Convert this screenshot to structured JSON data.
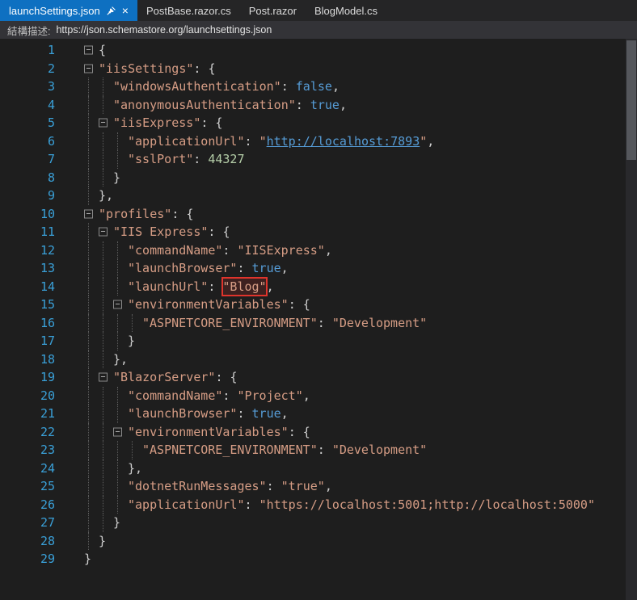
{
  "tabs": [
    {
      "label": "launchSettings.json",
      "active": true
    },
    {
      "label": "PostBase.razor.cs",
      "active": false
    },
    {
      "label": "Post.razor",
      "active": false
    },
    {
      "label": "BlogModel.cs",
      "active": false
    }
  ],
  "icons": {
    "close": "×",
    "fold_collapse": "−"
  },
  "schema_bar": {
    "label": "結構描述:",
    "url": "https://json.schemastore.org/launchsettings.json"
  },
  "colors": {
    "accent": "#0e70c1",
    "editor_bg": "#1e1e1e",
    "tabbar_bg": "#252526",
    "schemabar_bg": "#333337",
    "line_number": "#3aa0d8",
    "string": "#d69d85",
    "keyword": "#569cd6",
    "number": "#b5cea8",
    "punctuation": "#d0d0d0",
    "link": "#569cd6",
    "highlight_red": "#e0342c"
  },
  "editor": {
    "lines": [
      {
        "n": 1,
        "pre": [
          "box"
        ],
        "tokens": [
          [
            "punc",
            "{"
          ]
        ]
      },
      {
        "n": 2,
        "pre": [
          "box"
        ],
        "tokens": [
          [
            "str",
            "\"iisSettings\""
          ],
          [
            "punc",
            ": {"
          ]
        ]
      },
      {
        "n": 3,
        "pre": [
          "g",
          "g"
        ],
        "tokens": [
          [
            "str",
            "\"windowsAuthentication\""
          ],
          [
            "punc",
            ": "
          ],
          [
            "kw",
            "false"
          ],
          [
            "punc",
            ","
          ]
        ]
      },
      {
        "n": 4,
        "pre": [
          "g",
          "g"
        ],
        "tokens": [
          [
            "str",
            "\"anonymousAuthentication\""
          ],
          [
            "punc",
            ": "
          ],
          [
            "kw",
            "true"
          ],
          [
            "punc",
            ","
          ]
        ]
      },
      {
        "n": 5,
        "pre": [
          "g",
          "box"
        ],
        "tokens": [
          [
            "str",
            "\"iisExpress\""
          ],
          [
            "punc",
            ": {"
          ]
        ]
      },
      {
        "n": 6,
        "pre": [
          "g",
          "g",
          "g"
        ],
        "tokens": [
          [
            "str",
            "\"applicationUrl\""
          ],
          [
            "punc",
            ": "
          ],
          [
            "str",
            "\""
          ],
          [
            "link",
            "http://localhost:7893"
          ],
          [
            "str",
            "\""
          ],
          [
            "punc",
            ","
          ]
        ]
      },
      {
        "n": 7,
        "pre": [
          "g",
          "g",
          "g"
        ],
        "tokens": [
          [
            "str",
            "\"sslPort\""
          ],
          [
            "punc",
            ": "
          ],
          [
            "num",
            "44327"
          ]
        ]
      },
      {
        "n": 8,
        "pre": [
          "g",
          "g"
        ],
        "tokens": [
          [
            "punc",
            "}"
          ]
        ]
      },
      {
        "n": 9,
        "pre": [
          "g"
        ],
        "tokens": [
          [
            "punc",
            "},"
          ]
        ]
      },
      {
        "n": 10,
        "pre": [
          "box"
        ],
        "tokens": [
          [
            "str",
            "\"profiles\""
          ],
          [
            "punc",
            ": {"
          ]
        ]
      },
      {
        "n": 11,
        "pre": [
          "g",
          "box"
        ],
        "tokens": [
          [
            "str",
            "\"IIS Express\""
          ],
          [
            "punc",
            ": {"
          ]
        ]
      },
      {
        "n": 12,
        "pre": [
          "g",
          "g",
          "g"
        ],
        "tokens": [
          [
            "str",
            "\"commandName\""
          ],
          [
            "punc",
            ": "
          ],
          [
            "str",
            "\"IISExpress\""
          ],
          [
            "punc",
            ","
          ]
        ]
      },
      {
        "n": 13,
        "pre": [
          "g",
          "g",
          "g"
        ],
        "tokens": [
          [
            "str",
            "\"launchBrowser\""
          ],
          [
            "punc",
            ": "
          ],
          [
            "kw",
            "true"
          ],
          [
            "punc",
            ","
          ]
        ]
      },
      {
        "n": 14,
        "pre": [
          "g",
          "g",
          "g"
        ],
        "tokens": [
          [
            "str",
            "\"launchUrl\""
          ],
          [
            "punc",
            ": "
          ],
          [
            "hl",
            "\"Blog\""
          ],
          [
            "punc",
            ","
          ]
        ]
      },
      {
        "n": 15,
        "pre": [
          "g",
          "g",
          "box"
        ],
        "tokens": [
          [
            "str",
            "\"environmentVariables\""
          ],
          [
            "punc",
            ": {"
          ]
        ]
      },
      {
        "n": 16,
        "pre": [
          "g",
          "g",
          "g",
          "g"
        ],
        "tokens": [
          [
            "str",
            "\"ASPNETCORE_ENVIRONMENT\""
          ],
          [
            "punc",
            ": "
          ],
          [
            "str",
            "\"Development\""
          ]
        ]
      },
      {
        "n": 17,
        "pre": [
          "g",
          "g",
          "g"
        ],
        "tokens": [
          [
            "punc",
            "}"
          ]
        ]
      },
      {
        "n": 18,
        "pre": [
          "g",
          "g"
        ],
        "tokens": [
          [
            "punc",
            "},"
          ]
        ]
      },
      {
        "n": 19,
        "pre": [
          "g",
          "box"
        ],
        "tokens": [
          [
            "str",
            "\"BlazorServer\""
          ],
          [
            "punc",
            ": {"
          ]
        ]
      },
      {
        "n": 20,
        "pre": [
          "g",
          "g",
          "g"
        ],
        "tokens": [
          [
            "str",
            "\"commandName\""
          ],
          [
            "punc",
            ": "
          ],
          [
            "str",
            "\"Project\""
          ],
          [
            "punc",
            ","
          ]
        ]
      },
      {
        "n": 21,
        "pre": [
          "g",
          "g",
          "g"
        ],
        "tokens": [
          [
            "str",
            "\"launchBrowser\""
          ],
          [
            "punc",
            ": "
          ],
          [
            "kw",
            "true"
          ],
          [
            "punc",
            ","
          ]
        ]
      },
      {
        "n": 22,
        "pre": [
          "g",
          "g",
          "box"
        ],
        "tokens": [
          [
            "str",
            "\"environmentVariables\""
          ],
          [
            "punc",
            ": {"
          ]
        ]
      },
      {
        "n": 23,
        "pre": [
          "g",
          "g",
          "g",
          "g"
        ],
        "tokens": [
          [
            "str",
            "\"ASPNETCORE_ENVIRONMENT\""
          ],
          [
            "punc",
            ": "
          ],
          [
            "str",
            "\"Development\""
          ]
        ]
      },
      {
        "n": 24,
        "pre": [
          "g",
          "g",
          "g"
        ],
        "tokens": [
          [
            "punc",
            "},"
          ]
        ]
      },
      {
        "n": 25,
        "pre": [
          "g",
          "g",
          "g"
        ],
        "tokens": [
          [
            "str",
            "\"dotnetRunMessages\""
          ],
          [
            "punc",
            ": "
          ],
          [
            "str",
            "\"true\""
          ],
          [
            "punc",
            ","
          ]
        ]
      },
      {
        "n": 26,
        "pre": [
          "g",
          "g",
          "g"
        ],
        "tokens": [
          [
            "str",
            "\"applicationUrl\""
          ],
          [
            "punc",
            ": "
          ],
          [
            "str",
            "\"https://localhost:5001;http://localhost:5000\""
          ]
        ]
      },
      {
        "n": 27,
        "pre": [
          "g",
          "g"
        ],
        "tokens": [
          [
            "punc",
            "}"
          ]
        ]
      },
      {
        "n": 28,
        "pre": [
          "g"
        ],
        "tokens": [
          [
            "punc",
            "}"
          ]
        ]
      },
      {
        "n": 29,
        "pre": [],
        "tokens": [
          [
            "punc",
            "}"
          ]
        ]
      }
    ]
  }
}
